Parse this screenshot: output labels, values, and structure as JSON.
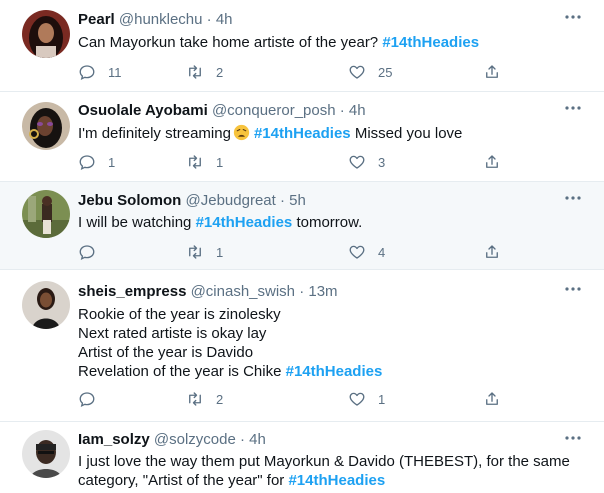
{
  "tweets": [
    {
      "name": "Pearl",
      "handle": "@hunklechu",
      "sep": "·",
      "time": "4h",
      "lines": [
        "Can Mayorkun take home artiste of the year?"
      ],
      "hashtag": "#14thHeadies",
      "replies": "11",
      "retweets": "2",
      "likes": "25"
    },
    {
      "name": "Osuolale Ayobami",
      "handle": "@conqueror_posh",
      "sep": "·",
      "time": "4h",
      "text_before": "I'm definitely streaming",
      "emoji": "weary-face-emoji",
      "hashtag": "#14thHeadies",
      "text_after": "Missed you love",
      "replies": "1",
      "retweets": "1",
      "likes": "3"
    },
    {
      "name": "Jebu Solomon",
      "handle": "@Jebudgreat",
      "sep": "·",
      "time": "5h",
      "text_before": "I will be watching",
      "hashtag": "#14thHeadies",
      "text_after": "tomorrow.",
      "replies": "",
      "retweets": "1",
      "likes": "4"
    },
    {
      "name": "sheis_empress",
      "handle": "@cinash_swish",
      "sep": "·",
      "time": "13m",
      "lines": [
        "Rookie of the year is zinolesky",
        "Next rated artiste is okay lay",
        "Artist of the year is Davido",
        "Revelation of the year is Chike"
      ],
      "hashtag": "#14thHeadies",
      "replies": "",
      "retweets": "2",
      "likes": "1"
    },
    {
      "name": "Iam_solzy",
      "handle": "@solzycode",
      "sep": "·",
      "time": "4h",
      "lines": [
        "I just love the way them put Mayorkun & Davido (THEBEST), for the same",
        "category, \"Artist of the year\" for"
      ],
      "hashtag": "#14thHeadies"
    }
  ],
  "colors": {
    "accent": "#1da1f2",
    "secondary_text": "#5b7083",
    "highlight_bg": "#f5f8fa",
    "divider": "#e6ecf0"
  }
}
